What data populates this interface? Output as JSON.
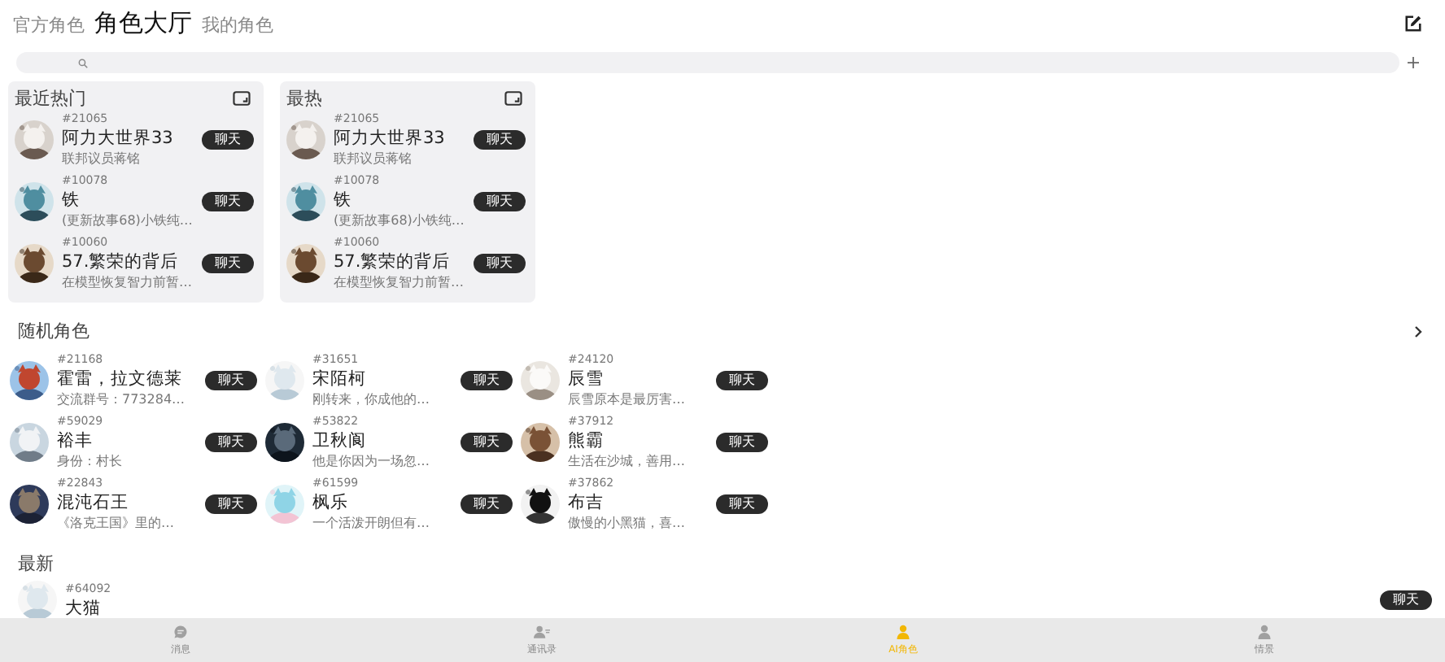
{
  "header": {
    "tabs": [
      {
        "label": "官方角色",
        "selected": false
      },
      {
        "label": "角色大厅",
        "selected": true
      },
      {
        "label": "我的角色",
        "selected": false
      }
    ]
  },
  "hot_lists": [
    {
      "title": "最近热门",
      "items": [
        {
          "id": "#21065",
          "name": "阿力大世界33",
          "desc": "联邦议员蒋铭",
          "button": "聊天"
        },
        {
          "id": "#10078",
          "name": "铁",
          "desc": "(更新故事68)小铁纯…",
          "button": "聊天"
        },
        {
          "id": "#10060",
          "name": "57.繁荣的背后",
          "desc": "在模型恢复智力前暂…",
          "button": "聊天"
        }
      ]
    },
    {
      "title": "最热",
      "items": [
        {
          "id": "#21065",
          "name": "阿力大世界33",
          "desc": "联邦议员蒋铭",
          "button": "聊天"
        },
        {
          "id": "#10078",
          "name": "铁",
          "desc": "(更新故事68)小铁纯…",
          "button": "聊天"
        },
        {
          "id": "#10060",
          "name": "57.繁荣的背后",
          "desc": "在模型恢复智力前暂…",
          "button": "聊天"
        }
      ]
    }
  ],
  "random": {
    "title": "随机角色",
    "items": [
      {
        "id": "#21168",
        "name": "霍雷，拉文德莱",
        "desc": "交流群号：773284…",
        "button": "聊天"
      },
      {
        "id": "#31651",
        "name": "宋陌柯",
        "desc": "刚转来，你成他的…",
        "button": "聊天"
      },
      {
        "id": "#24120",
        "name": "辰雪",
        "desc": "辰雪原本是最厉害…",
        "button": "聊天"
      },
      {
        "id": "#59029",
        "name": "裕丰",
        "desc": "身份：村长",
        "button": "聊天"
      },
      {
        "id": "#53822",
        "name": "卫秋阆",
        "desc": "他是你因为一场忽…",
        "button": "聊天"
      },
      {
        "id": "#37912",
        "name": "熊霸",
        "desc": "生活在沙城，善用…",
        "button": "聊天"
      },
      {
        "id": "#22843",
        "name": "混沌石王",
        "desc": "《洛克王国》里的…",
        "button": "聊天"
      },
      {
        "id": "#61599",
        "name": "枫乐",
        "desc": "一个活泼开朗但有…",
        "button": "聊天"
      },
      {
        "id": "#37862",
        "name": "布吉",
        "desc": "傲慢的小黑猫，喜…",
        "button": "聊天"
      }
    ]
  },
  "latest": {
    "title": "最新",
    "items": [
      {
        "id": "#64092",
        "name": "大猫",
        "button": "聊天"
      }
    ]
  },
  "nav": [
    {
      "label": "消息",
      "kind": "chat",
      "selected": false
    },
    {
      "label": "通讯录",
      "kind": "contacts",
      "selected": false
    },
    {
      "label": "AI角色",
      "kind": "person",
      "selected": true
    },
    {
      "label": "情景",
      "kind": "person",
      "selected": false
    }
  ]
}
